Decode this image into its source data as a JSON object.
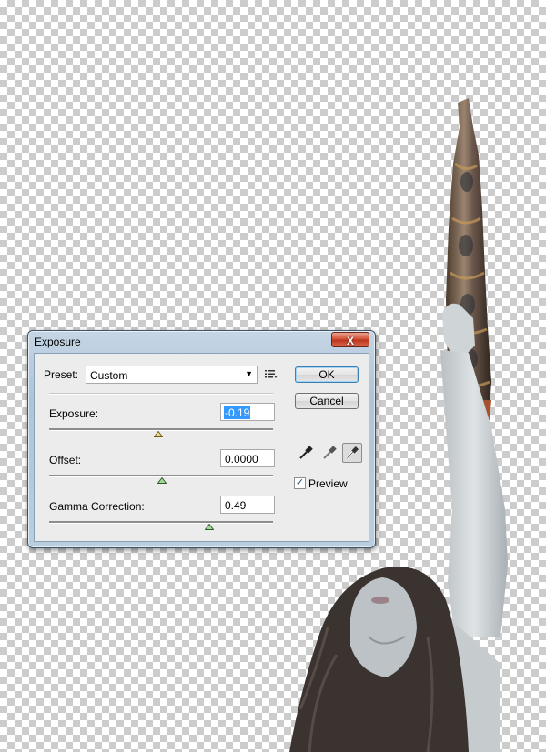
{
  "dialog": {
    "title": "Exposure",
    "close_label": "X",
    "preset": {
      "label": "Preset:",
      "value": "Custom"
    },
    "exposure": {
      "label": "Exposure:",
      "value": "-0.19"
    },
    "offset": {
      "label": "Offset:",
      "value": "0.0000"
    },
    "gamma": {
      "label": "Gamma Correction:",
      "value": "0.49"
    },
    "ok_label": "OK",
    "cancel_label": "Cancel",
    "preview": {
      "label": "Preview",
      "checked": true,
      "check_glyph": "✓"
    },
    "icons": [
      "preset-menu-icon",
      "black-eyedropper-icon",
      "gray-eyedropper-icon",
      "white-eyedropper-icon"
    ]
  },
  "colors": {
    "title_gradient": "#b9cede",
    "close_red": "#c9432a",
    "selection_blue": "#3399ff"
  }
}
